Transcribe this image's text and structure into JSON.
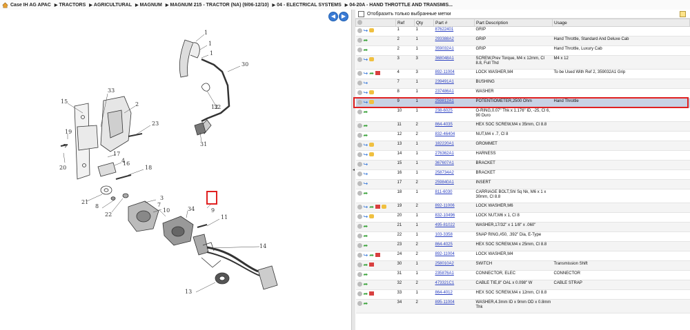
{
  "breadcrumb": [
    "Case IH AG APAC",
    "TRACTORS",
    "AGRICULTURAL",
    "MAGNUM",
    "MAGNUM 215 - TRACTOR (NA) (9/06-12/10)",
    "04 - ELECTRICAL SYSTEMS",
    "04-20A - HAND THROTTLE AND TRANSMIS..."
  ],
  "nav": {
    "back_symbol": "◀",
    "forward_symbol": "▶"
  },
  "filter": {
    "label": "Отобразить только выбранные метки"
  },
  "table": {
    "headers": [
      "Ref",
      "Qty",
      "Part #",
      "Part Description",
      "Usage"
    ],
    "rows": [
      {
        "icons": [
          "o",
          "b",
          "y"
        ],
        "ref": "1",
        "qty": "1",
        "part": "87622401",
        "desc": "GRIP",
        "usage": ""
      },
      {
        "icons": [
          "o",
          "g"
        ],
        "ref": "2",
        "qty": "1",
        "part": "293388A2",
        "desc": "GRIP",
        "usage": "Hand Throttle, Standard And Deluxe Cab"
      },
      {
        "icons": [
          "o",
          "g"
        ],
        "ref": "2",
        "qty": "1",
        "part": "359032A1",
        "desc": "GRIP",
        "usage": "Hand Throttle, Luxury Cab"
      },
      {
        "icons": [
          "o",
          "b",
          "y"
        ],
        "ref": "3",
        "qty": "3",
        "part": "368048A1",
        "desc": "SCREW,Prev Torque, M4 x 12mm, Cl 8.8, Full Thd",
        "usage": "M4 x 12"
      },
      {
        "icons": [
          "o",
          "b",
          "g",
          "r"
        ],
        "ref": "4",
        "qty": "3",
        "part": "892-11004",
        "desc": "LOCK WASHER,M4",
        "usage": "To be Used With Ref 2, 359032A1 Grip"
      },
      {
        "icons": [
          "o",
          "b"
        ],
        "ref": "7",
        "qty": "1",
        "part": "239491A1",
        "desc": "BUSHING",
        "usage": ""
      },
      {
        "icons": [
          "o",
          "b",
          "y"
        ],
        "ref": "8",
        "qty": "1",
        "part": "237486A1",
        "desc": "WASHER",
        "usage": ""
      },
      {
        "icons": [
          "o",
          "b",
          "y"
        ],
        "ref": "9",
        "qty": "1",
        "part": "259812A1",
        "desc": "POTENTIOMETER,2500 Ohm",
        "usage": "Hand Throttle",
        "selected": true
      },
      {
        "icons": [
          "o",
          "g"
        ],
        "ref": "10",
        "qty": "1",
        "part": "238-6025",
        "desc": "O-RING,0.07\" Thk x 1.176\" ID, -25, Cl 6, 90 Duro",
        "usage": ""
      },
      {
        "icons": [
          "o",
          "g"
        ],
        "ref": "11",
        "qty": "2",
        "part": "864-4035",
        "desc": "HEX SOC SCREW,M4 x 35mm, Cl 8.8",
        "usage": ""
      },
      {
        "icons": [
          "o",
          "g"
        ],
        "ref": "12",
        "qty": "2",
        "part": "832-46404",
        "desc": "NUT,M4 x .7, Cl 8",
        "usage": ""
      },
      {
        "icons": [
          "o",
          "b",
          "y"
        ],
        "ref": "13",
        "qty": "1",
        "part": "182220A1",
        "desc": "GROMMET",
        "usage": ""
      },
      {
        "icons": [
          "o",
          "b",
          "y"
        ],
        "ref": "14",
        "qty": "1",
        "part": "276362A1",
        "desc": "HARNESS",
        "usage": ""
      },
      {
        "icons": [
          "o",
          "b"
        ],
        "ref": "15",
        "qty": "1",
        "part": "367607A1",
        "desc": "BRACKET",
        "usage": ""
      },
      {
        "icons": [
          "o",
          "b"
        ],
        "ref": "16",
        "qty": "1",
        "part": "258734A2",
        "desc": "BRACKET",
        "usage": ""
      },
      {
        "icons": [
          "o",
          "b"
        ],
        "ref": "17",
        "qty": "2",
        "part": "259840A1",
        "desc": "INSERT",
        "usage": ""
      },
      {
        "icons": [
          "o",
          "g"
        ],
        "ref": "18",
        "qty": "1",
        "part": "811-6030",
        "desc": "CARRIAGE BOLT,Shl Sq Nk, M6 x 1 x 30mm, Cl 8.8",
        "usage": ""
      },
      {
        "icons": [
          "o",
          "b",
          "g",
          "r",
          "y"
        ],
        "ref": "19",
        "qty": "2",
        "part": "892-11006",
        "desc": "LOCK WASHER,M6",
        "usage": ""
      },
      {
        "icons": [
          "o",
          "b",
          "y"
        ],
        "ref": "20",
        "qty": "1",
        "part": "832-10496",
        "desc": "LOCK NUT,M6 x 1, Cl 8",
        "usage": ""
      },
      {
        "icons": [
          "o",
          "g"
        ],
        "ref": "21",
        "qty": "1",
        "part": "495-81022",
        "desc": "WASHER,17/32\" x 1 1/8\" x .060\"",
        "usage": ""
      },
      {
        "icons": [
          "o",
          "g"
        ],
        "ref": "22",
        "qty": "1",
        "part": "103-3358",
        "desc": "SNAP RING,#50, .392\" Dia, E-Type",
        "usage": ""
      },
      {
        "icons": [
          "o",
          "g"
        ],
        "ref": "23",
        "qty": "2",
        "part": "864-4025",
        "desc": "HEX SOC SCREW,M4 x 25mm, Cl 8.8",
        "usage": ""
      },
      {
        "icons": [
          "o",
          "b",
          "g",
          "r"
        ],
        "ref": "24",
        "qty": "2",
        "part": "892-11004",
        "desc": "LOCK WASHER,M4",
        "usage": ""
      },
      {
        "icons": [
          "o",
          "g",
          "r"
        ],
        "ref": "30",
        "qty": "1",
        "part": "258010A2",
        "desc": "SWITCH",
        "usage": "Transmission Shift"
      },
      {
        "icons": [
          "o",
          "g"
        ],
        "ref": "31",
        "qty": "1",
        "part": "235876A1",
        "desc": "CONNECTOR, ELEC",
        "usage": "CONNECTOR"
      },
      {
        "icons": [
          "o",
          "g"
        ],
        "ref": "32",
        "qty": "2",
        "part": "473321C1",
        "desc": "CABLE TIE,8\" OAL x 0.098\" W",
        "usage": "CABLE STRAP"
      },
      {
        "icons": [
          "o",
          "g",
          "r"
        ],
        "ref": "33",
        "qty": "1",
        "part": "864-4012",
        "desc": "HEX SOC SCREW,M4 x 12mm, Cl 8.8",
        "usage": ""
      },
      {
        "icons": [
          "o",
          "g"
        ],
        "ref": "34",
        "qty": "2",
        "part": "895-11004",
        "desc": "WASHER,4.3mm ID x 9mm OD x 0.8mm Thk",
        "usage": ""
      }
    ]
  },
  "diagram": {
    "callouts": [
      "1",
      "1",
      "1",
      "2",
      "3",
      "4",
      "7",
      "8",
      "9",
      "10",
      "11",
      "12",
      "13",
      "14",
      "15",
      "16",
      "17",
      "18",
      "19",
      "20",
      "21",
      "22",
      "23",
      "30",
      "31",
      "32",
      "33",
      "34"
    ]
  },
  "colors": {
    "highlight": "#e02020",
    "link": "#2a3fc0",
    "selected_row": "#c8d2e4"
  }
}
